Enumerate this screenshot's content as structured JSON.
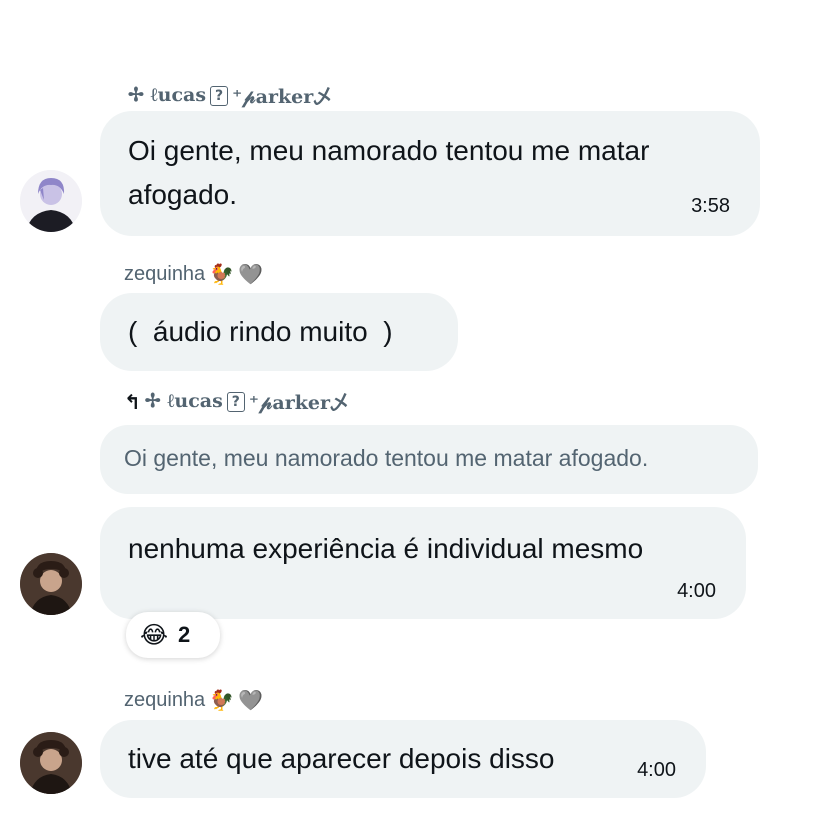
{
  "messages": [
    {
      "sender": {
        "prefix": "✢ ℓucas",
        "qmark": "?",
        "suffix": "⁺𝓅arker乄"
      },
      "text_line1": "Oi gente, meu namorado tentou me matar",
      "text_line2": "afogado.",
      "time": "3:58"
    },
    {
      "sender": {
        "name": "zequinha",
        "emoji1": "🐓",
        "emoji2": "🩶"
      },
      "text": "(  áudio rindo muito  )"
    },
    {
      "reply_to": {
        "arrow": "↰",
        "prefix": "✢ ℓucas",
        "qmark": "?",
        "suffix": "⁺𝓅arker乄"
      },
      "quote": "Oi gente, meu namorado tentou me matar afogado.",
      "text": "nenhuma experiência é individual mesmo",
      "time": "4:00",
      "reaction": {
        "emoji": "😂",
        "count": "2"
      }
    },
    {
      "sender": {
        "name": "zequinha",
        "emoji1": "🐓",
        "emoji2": "🩶"
      },
      "text": "tive até que aparecer depois disso",
      "time": "4:00"
    }
  ],
  "colors": {
    "bubble": "#eff3f4",
    "secondary_text": "#536471",
    "primary_text": "#0f1419"
  },
  "icons": [
    "avatar-purple-hair",
    "avatar-curly-hair",
    "reply-arrow-icon",
    "laughing-emoji-icon"
  ]
}
